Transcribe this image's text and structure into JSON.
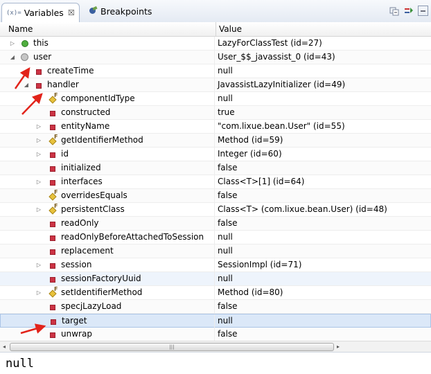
{
  "tabs": [
    {
      "label": "Variables",
      "icon_text": "(x)=",
      "active": true,
      "close": "☒"
    },
    {
      "label": "Breakpoints",
      "active": false
    }
  ],
  "toolbar": {
    "icons": [
      "collapse-all-icon",
      "show-types-icon",
      "minimize-icon"
    ]
  },
  "columns": {
    "name": "Name",
    "value": "Value"
  },
  "rows": [
    {
      "name": "this",
      "value": "LazyForClassTest  (id=27)",
      "level": 0,
      "twisty": "▷",
      "icon": "green-circle"
    },
    {
      "name": "user",
      "value": "User_$$_javassist_0  (id=43)",
      "level": 0,
      "twisty": "◢",
      "icon": "gray-circle"
    },
    {
      "name": "createTime",
      "value": "null",
      "level": 1,
      "twisty": "",
      "icon": "red-square"
    },
    {
      "name": "handler",
      "value": "JavassistLazyInitializer  (id=49)",
      "level": 1,
      "twisty": "◢",
      "icon": "red-square"
    },
    {
      "name": "componentIdType",
      "value": "null",
      "level": 2,
      "twisty": "",
      "icon": "yellow-final"
    },
    {
      "name": "constructed",
      "value": "true",
      "level": 2,
      "twisty": "",
      "icon": "red-square"
    },
    {
      "name": "entityName",
      "value": "\"com.lixue.bean.User\" (id=55)",
      "level": 2,
      "twisty": "▷",
      "icon": "red-square"
    },
    {
      "name": "getIdentifierMethod",
      "value": "Method  (id=59)",
      "level": 2,
      "twisty": "▷",
      "icon": "yellow-final"
    },
    {
      "name": "id",
      "value": "Integer  (id=60)",
      "level": 2,
      "twisty": "▷",
      "icon": "red-square"
    },
    {
      "name": "initialized",
      "value": "false",
      "level": 2,
      "twisty": "",
      "icon": "red-square"
    },
    {
      "name": "interfaces",
      "value": "Class<T>[1]  (id=64)",
      "level": 2,
      "twisty": "▷",
      "icon": "red-square"
    },
    {
      "name": "overridesEquals",
      "value": "false",
      "level": 2,
      "twisty": "",
      "icon": "yellow-final"
    },
    {
      "name": "persistentClass",
      "value": "Class<T> (com.lixue.bean.User) (id=48)",
      "level": 2,
      "twisty": "▷",
      "icon": "yellow-final"
    },
    {
      "name": "readOnly",
      "value": "false",
      "level": 2,
      "twisty": "",
      "icon": "red-square"
    },
    {
      "name": "readOnlyBeforeAttachedToSession",
      "value": "null",
      "level": 2,
      "twisty": "",
      "icon": "red-square"
    },
    {
      "name": "replacement",
      "value": "null",
      "level": 2,
      "twisty": "",
      "icon": "red-square"
    },
    {
      "name": "session",
      "value": "SessionImpl  (id=71)",
      "level": 2,
      "twisty": "▷",
      "icon": "red-square"
    },
    {
      "name": "sessionFactoryUuid",
      "value": "null",
      "level": 2,
      "twisty": "",
      "icon": "red-square"
    },
    {
      "name": "setIdentifierMethod",
      "value": "Method  (id=80)",
      "level": 2,
      "twisty": "▷",
      "icon": "yellow-final"
    },
    {
      "name": "specjLazyLoad",
      "value": "false",
      "level": 2,
      "twisty": "",
      "icon": "red-square"
    },
    {
      "name": "target",
      "value": "null",
      "level": 2,
      "twisty": "",
      "icon": "red-square",
      "selected": true
    },
    {
      "name": "unwrap",
      "value": "false",
      "level": 2,
      "twisty": "",
      "icon": "red-square"
    }
  ],
  "scrollbar": {
    "left": "◂",
    "grip": "|||",
    "right": "▸"
  },
  "detail": {
    "text": "null"
  },
  "colors": {
    "accent": "#3a5fa0",
    "selected_row": "#dbe8f8",
    "annotation_arrow": "#e2231a"
  }
}
